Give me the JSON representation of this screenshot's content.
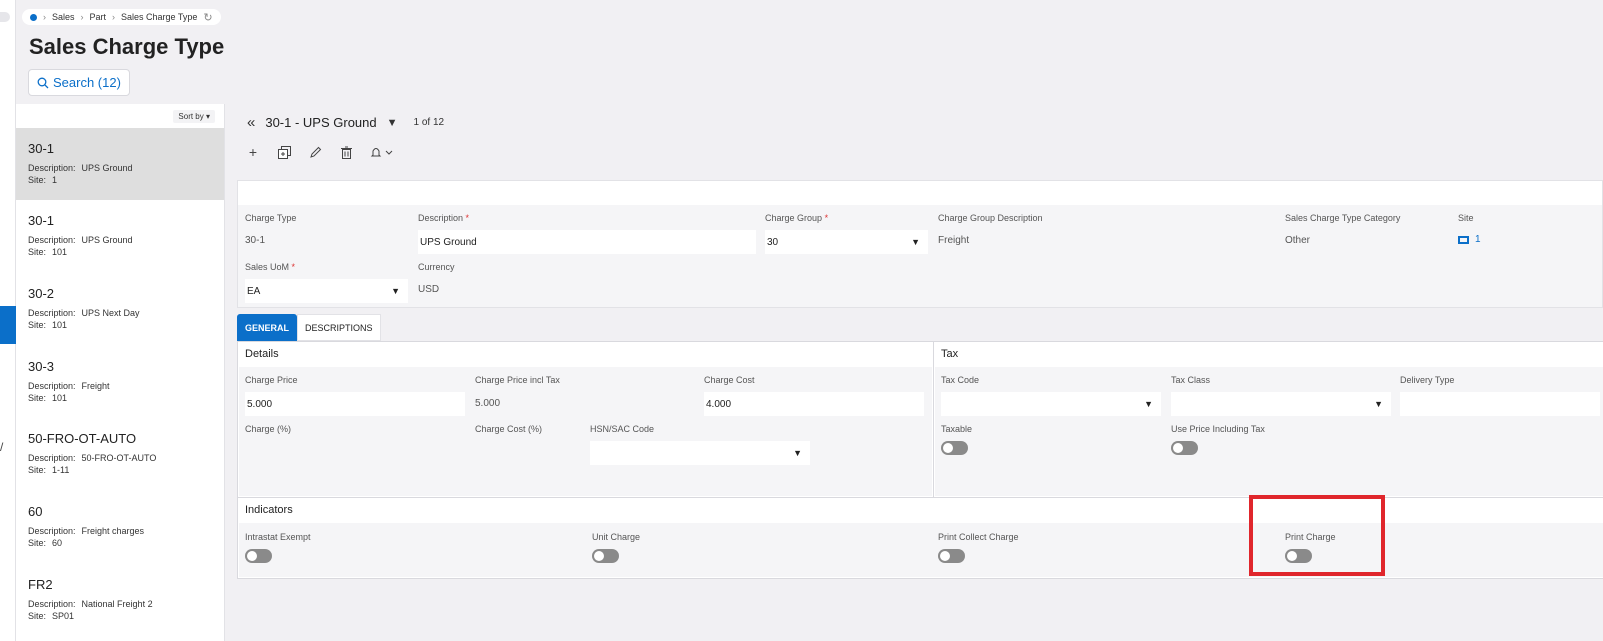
{
  "breadcrumb": {
    "items": [
      "Sales",
      "Part",
      "Sales Charge Type"
    ]
  },
  "page": {
    "title": "Sales Charge Type",
    "search_label": "Search (12)"
  },
  "list": {
    "sort_label": "Sort by",
    "items": [
      {
        "title": "30-1",
        "description": "UPS Ground",
        "site": "1"
      },
      {
        "title": "30-1",
        "description": "UPS Ground",
        "site": "101"
      },
      {
        "title": "30-2",
        "description": "UPS Next Day",
        "site": "101"
      },
      {
        "title": "30-3",
        "description": "Freight",
        "site": "101"
      },
      {
        "title": "50-FRO-OT-AUTO",
        "description": "50-FRO-OT-AUTO",
        "site": "1-11"
      },
      {
        "title": "60",
        "description": "Freight charges",
        "site": "60"
      },
      {
        "title": "FR2",
        "description": "National Freight 2",
        "site": "SP01"
      }
    ],
    "description_label": "Description:",
    "site_label": "Site:"
  },
  "record": {
    "title": "30-1 - UPS Ground",
    "count": "1 of 12"
  },
  "header": {
    "charge_type_label": "Charge Type",
    "charge_type": "30-1",
    "description_label": "Description",
    "description": "UPS Ground",
    "charge_group_label": "Charge Group",
    "charge_group": "30",
    "charge_group_desc_label": "Charge Group Description",
    "charge_group_desc": "Freight",
    "category_label": "Sales Charge Type Category",
    "category": "Other",
    "site_label": "Site",
    "site": "1",
    "uom_label": "Sales UoM",
    "uom": "EA",
    "currency_label": "Currency",
    "currency": "USD",
    "required_mark": "*"
  },
  "tabs": {
    "general": "GENERAL",
    "descriptions": "DESCRIPTIONS"
  },
  "details": {
    "title": "Details",
    "charge_price_label": "Charge Price",
    "charge_price": "5.000",
    "charge_price_incl_label": "Charge Price incl Tax",
    "charge_price_incl": "5.000",
    "charge_cost_label": "Charge Cost",
    "charge_cost": "4.000",
    "charge_pct_label": "Charge (%)",
    "charge_cost_pct_label": "Charge Cost (%)",
    "hsn_label": "HSN/SAC Code"
  },
  "tax": {
    "title": "Tax",
    "tax_code_label": "Tax Code",
    "tax_class_label": "Tax Class",
    "delivery_type_label": "Delivery Type",
    "taxable_label": "Taxable",
    "use_price_incl_label": "Use Price Including Tax"
  },
  "indicators": {
    "title": "Indicators",
    "intrastat_label": "Intrastat Exempt",
    "unit_charge_label": "Unit Charge",
    "print_collect_label": "Print Collect Charge",
    "print_charge_label": "Print Charge"
  },
  "colors": {
    "accent": "#0b6fc9",
    "highlight": "#e0262c",
    "toggle_off": "#8a8a8a"
  }
}
